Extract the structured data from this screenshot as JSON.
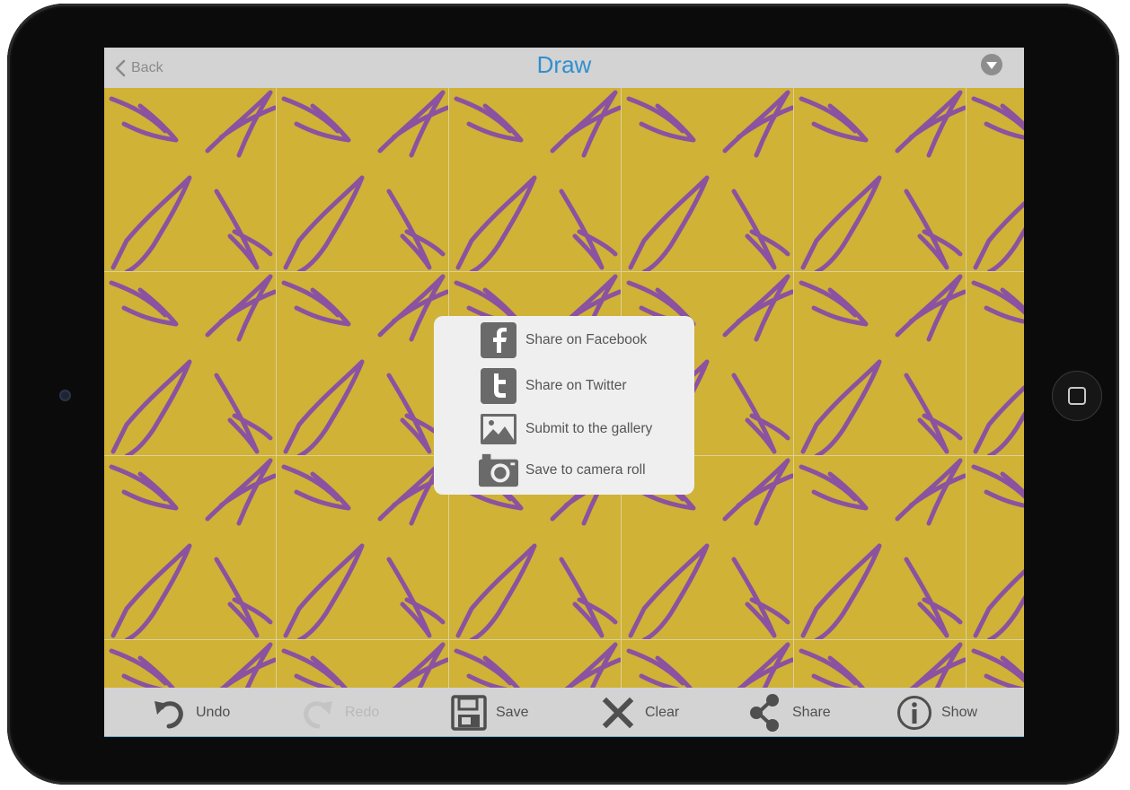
{
  "navbar": {
    "back_label": "Back",
    "title": "Draw",
    "menu_icon": "chevron-down-circle-icon"
  },
  "colors": {
    "canvas_background": "#cfb236",
    "stroke": "#8a52a0",
    "title": "#2f8fd0",
    "bar_background": "#d3d3d3",
    "popup_background": "#efefef"
  },
  "share_menu": {
    "items": [
      {
        "label": "Share on Facebook",
        "icon": "facebook-icon"
      },
      {
        "label": "Share on Twitter",
        "icon": "twitter-icon"
      },
      {
        "label": "Submit to the gallery",
        "icon": "gallery-image-icon"
      },
      {
        "label": "Save to camera roll",
        "icon": "camera-icon"
      }
    ]
  },
  "toolbar": {
    "items": [
      {
        "label": "Undo",
        "icon": "undo-icon",
        "enabled": true
      },
      {
        "label": "Redo",
        "icon": "redo-icon",
        "enabled": false
      },
      {
        "label": "Save",
        "icon": "floppy-disk-icon",
        "enabled": true
      },
      {
        "label": "Clear",
        "icon": "x-icon",
        "enabled": true
      },
      {
        "label": "Share",
        "icon": "share-icon",
        "enabled": true
      },
      {
        "label": "Show",
        "icon": "info-icon",
        "enabled": true
      }
    ]
  }
}
